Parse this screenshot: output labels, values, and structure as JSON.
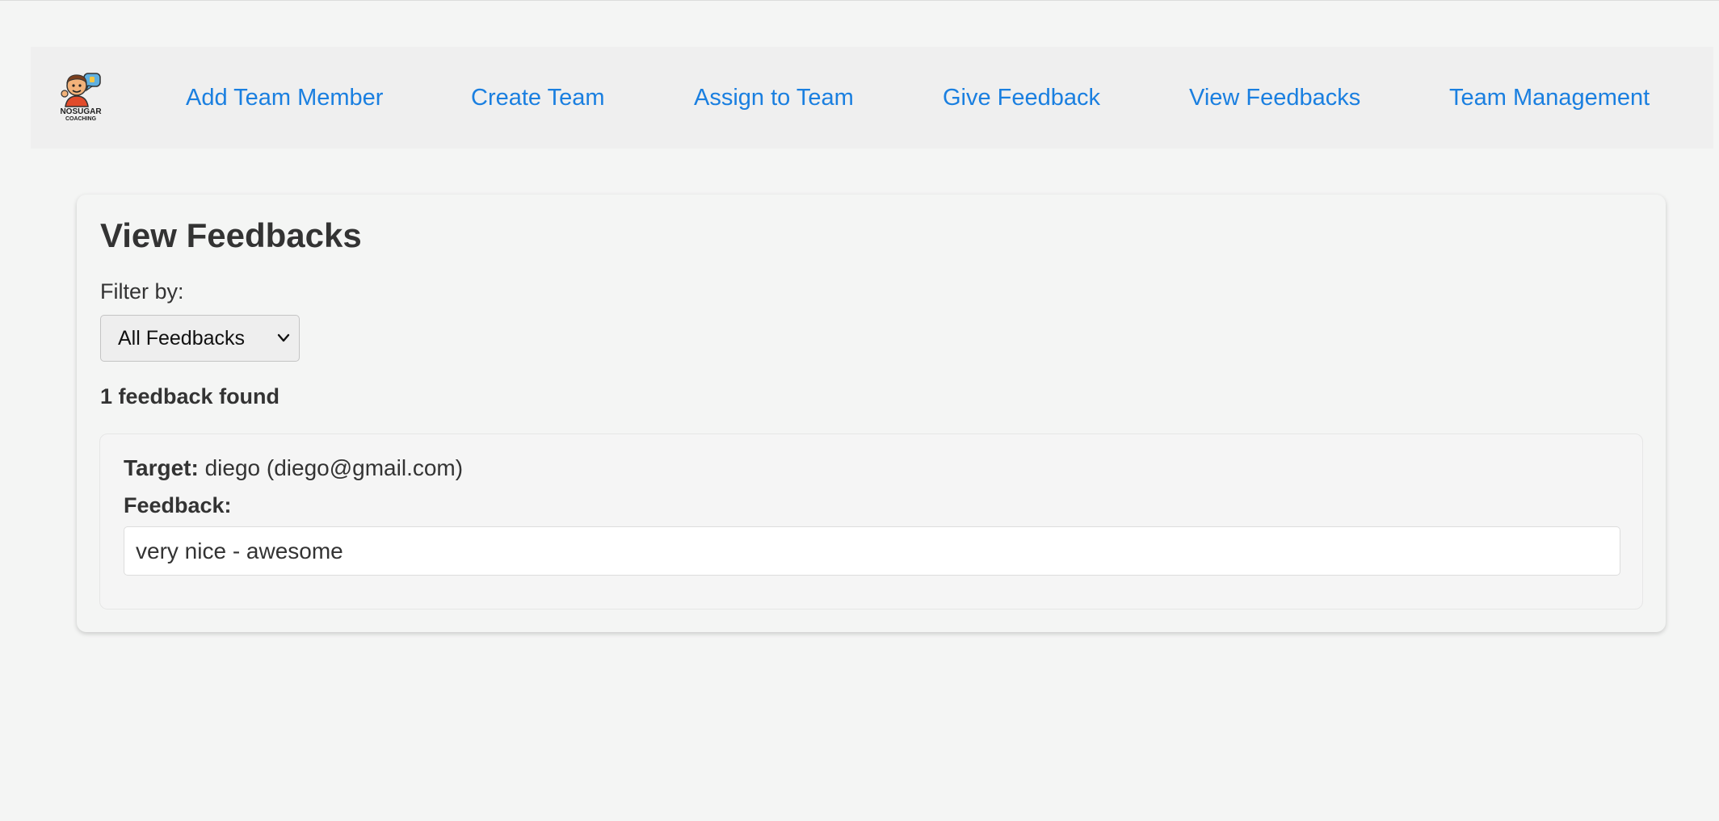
{
  "nav": {
    "logo_alt": "NOSUGAR COACHING",
    "logo_line1": "NOSUGAR",
    "logo_line2": "COACHING",
    "links": [
      {
        "label": "Add Team Member"
      },
      {
        "label": "Create Team"
      },
      {
        "label": "Assign to Team"
      },
      {
        "label": "Give Feedback"
      },
      {
        "label": "View Feedbacks"
      },
      {
        "label": "Team Management"
      }
    ],
    "link_color": "#1a7fe0"
  },
  "main": {
    "title": "View Feedbacks",
    "filter_label": "Filter by:",
    "filter_selected": "All Feedbacks",
    "count_text": "1 feedback found",
    "feedbacks": [
      {
        "target_label": "Target:",
        "target_value": "diego (diego@gmail.com)",
        "feedback_label": "Feedback:",
        "feedback_text": "very nice - awesome"
      }
    ]
  },
  "icons": {
    "logo": "coach-mascot-icon",
    "select_arrow": "chevron-down-icon"
  }
}
